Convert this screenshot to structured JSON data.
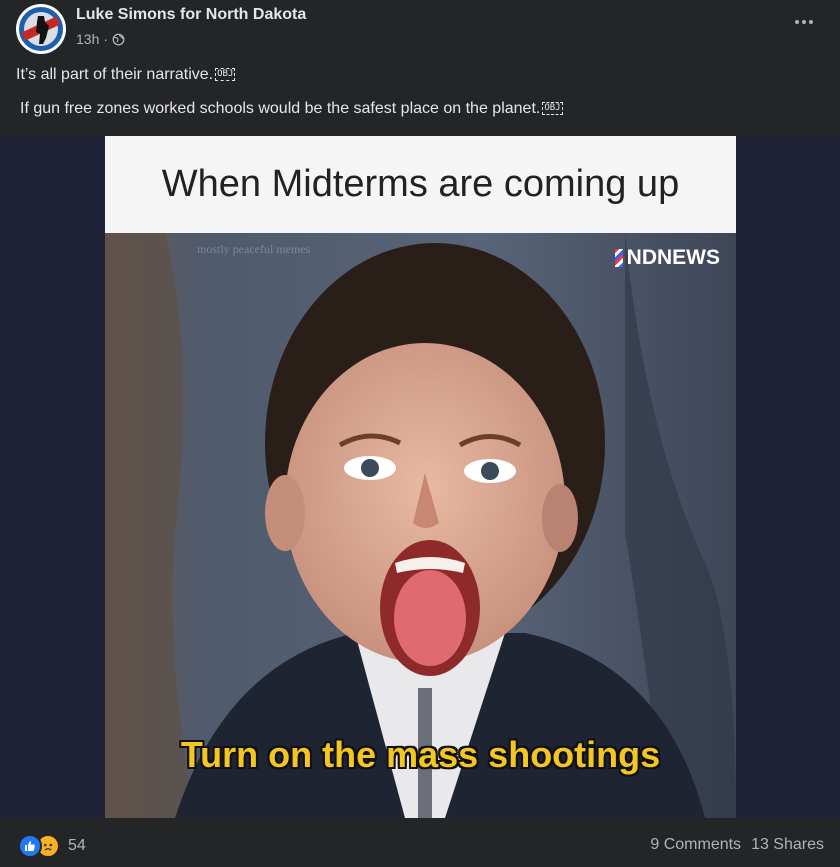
{
  "post": {
    "author": "Luke Simons for North Dakota",
    "time": "13h",
    "separator": "·",
    "text_line1": "It’s all part of their narrative.",
    "text_line2": "If gun free zones worked schools would be the safest place on the planet.",
    "obj_glyph": "OBJ",
    "privacy_icon": "globe-icon",
    "avatar_badge": "GOLDEN BADGE"
  },
  "meme": {
    "top_text": "When Midterms are coming up",
    "watermark": "mostly peaceful memes",
    "brand": "NDNEWS",
    "caption": "Turn on the mass shootings"
  },
  "footer": {
    "reaction_count": "54",
    "comments": "9 Comments",
    "shares": "13 Shares",
    "reaction_icons": [
      "like-icon",
      "sad-icon"
    ]
  },
  "colors": {
    "background": "#242526",
    "text": "#e4e6eb",
    "secondary_text": "#b0b3b8",
    "like_blue": "#2078f4",
    "sad_yellow": "#f7b125",
    "caption_yellow": "#f3c623"
  }
}
